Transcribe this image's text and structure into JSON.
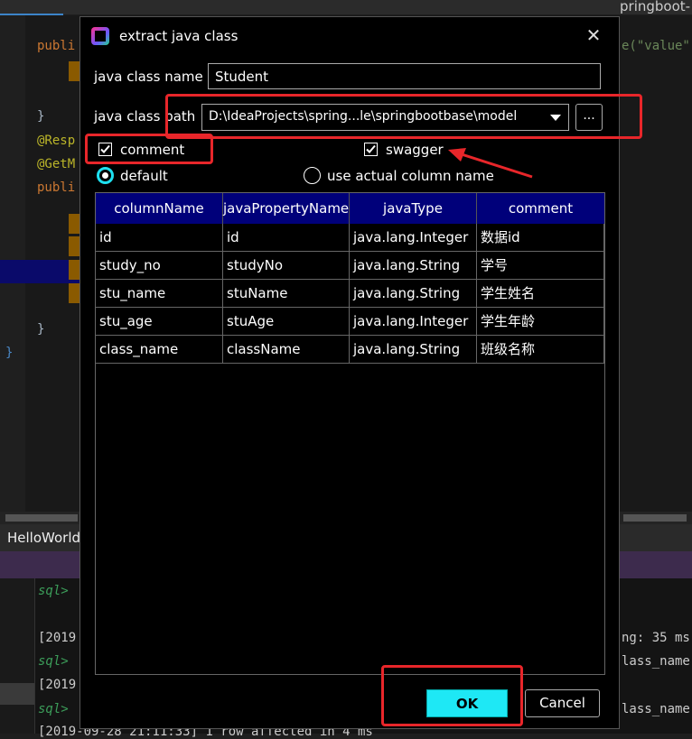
{
  "ide": {
    "right_tab_fragment": "pringboot-b",
    "code_fragment_right": "e(\"value\")",
    "left_code": [
      {
        "kw": "publi",
        "rest": ""
      },
      {
        "kw": "",
        "rest": "}"
      },
      {
        "kw": "",
        "rest": "@Resp"
      },
      {
        "kw": "",
        "rest": "@GetM"
      },
      {
        "kw": "publi",
        "rest": ""
      },
      {
        "kw": "",
        "rest": "}"
      },
      {
        "kw": "",
        "rest": "}"
      }
    ],
    "bottom_tab": "HelloWorld",
    "console_lines": [
      "sql>",
      "[2019",
      "sql>",
      "[2019",
      "sql>",
      "[2019-09-28 21:11:33] 1 row affected in 4 ms"
    ],
    "console_right": [
      "ng: 35 ms",
      "lass_name)",
      "lass_name)"
    ]
  },
  "dialog": {
    "title": "extract java class",
    "class_name_label": "java class name",
    "class_name_value": "Student",
    "class_path_label": "java class path",
    "class_path_value": "D:\\IdeaProjects\\spring...le\\springbootbase\\model",
    "browse_label": "...",
    "comment_label": "comment",
    "comment_checked": true,
    "swagger_label": "swagger",
    "swagger_checked": true,
    "radio_default_label": "default",
    "radio_actual_label": "use actual column name",
    "selected_radio": "default",
    "table": {
      "headers": [
        "columnName",
        "javaPropertyName",
        "javaType",
        "comment"
      ],
      "rows": [
        [
          "id",
          "id",
          "java.lang.Integer",
          "数据id"
        ],
        [
          "study_no",
          "studyNo",
          "java.lang.String",
          "学号"
        ],
        [
          "stu_name",
          "stuName",
          "java.lang.String",
          "学生姓名"
        ],
        [
          "stu_age",
          "stuAge",
          "java.lang.Integer",
          "学生年龄"
        ],
        [
          "class_name",
          "className",
          "java.lang.String",
          "班级名称"
        ]
      ]
    },
    "ok_label": "OK",
    "cancel_label": "Cancel"
  },
  "colors": {
    "accent_cyan": "#1ee8f5",
    "annotation_red": "#e8262a",
    "table_header": "#00007a"
  },
  "icons": [
    "app-icon",
    "close-icon",
    "dropdown-arrow-icon",
    "checkbox-check-icon",
    "arrow-annotation"
  ]
}
